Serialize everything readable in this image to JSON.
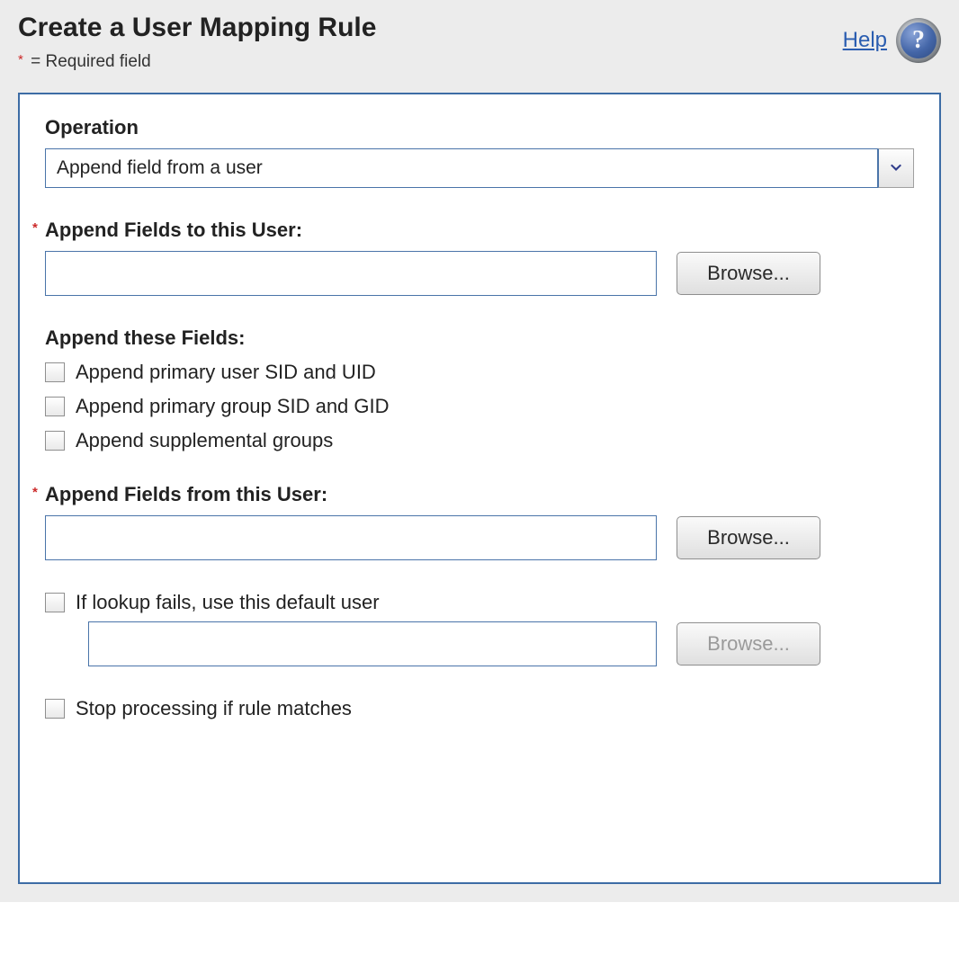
{
  "header": {
    "title": "Create a User Mapping Rule",
    "required_note_prefix": "*",
    "required_note_text": " = Required field",
    "help_label": "Help"
  },
  "form": {
    "operation": {
      "label": "Operation",
      "value": "Append field from a user"
    },
    "append_to_user": {
      "label": "Append Fields to this User:",
      "value": "",
      "browse_label": "Browse..."
    },
    "append_these_fields": {
      "label": "Append these Fields:",
      "options": [
        "Append primary user SID and UID",
        "Append primary group SID and GID",
        "Append supplemental groups"
      ]
    },
    "append_from_user": {
      "label": "Append Fields from this User:",
      "value": "",
      "browse_label": "Browse..."
    },
    "default_user": {
      "checkbox_label": "If lookup fails, use this default user",
      "value": "",
      "browse_label": "Browse..."
    },
    "stop_processing": {
      "label": "Stop processing if rule matches"
    }
  }
}
